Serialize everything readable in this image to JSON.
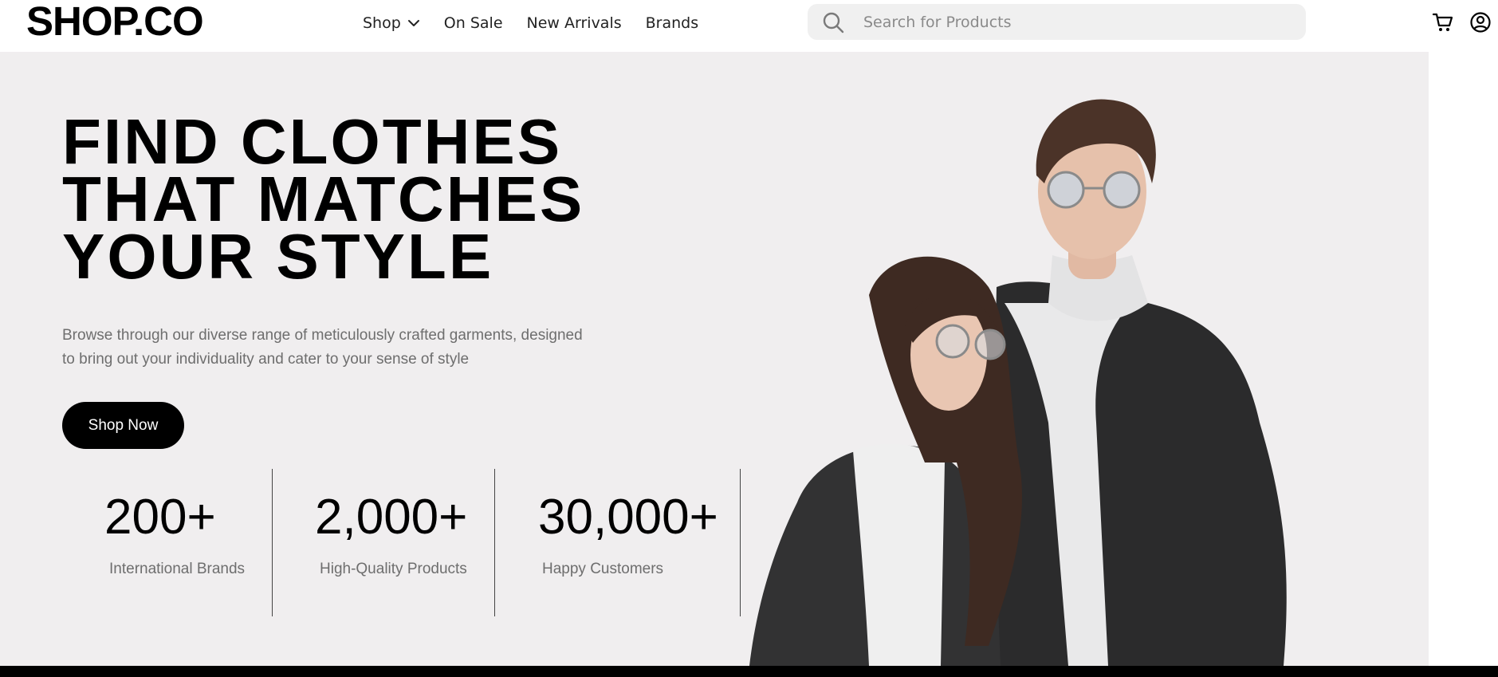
{
  "header": {
    "logo": "SHOP.CO",
    "nav": [
      {
        "label": "Shop",
        "has_dropdown": true
      },
      {
        "label": "On Sale"
      },
      {
        "label": "New Arrivals"
      },
      {
        "label": "Brands"
      }
    ],
    "search": {
      "placeholder": "Search for Products",
      "icon": "search-icon"
    },
    "icons": {
      "cart": "cart-icon",
      "user": "user-circle-icon"
    }
  },
  "hero": {
    "title_lines": [
      "FIND CLOTHES",
      "THAT MATCHES",
      "YOUR STYLE"
    ],
    "description_lines": [
      "Browse through our diverse range of meticulously crafted garments, designed",
      "to bring out your individuality and cater to your sense of style"
    ],
    "cta_label": "Shop Now",
    "stats": [
      {
        "value": "200+",
        "label": "International Brands"
      },
      {
        "value": "2,000+",
        "label": "High-Quality Products"
      },
      {
        "value": "30,000+",
        "label": "Happy Customers"
      }
    ]
  },
  "colors": {
    "hero_bg": "#f0eeef",
    "accent": "#000000",
    "muted_text": "#6e6e6e",
    "search_bg": "#f0f0f0"
  }
}
